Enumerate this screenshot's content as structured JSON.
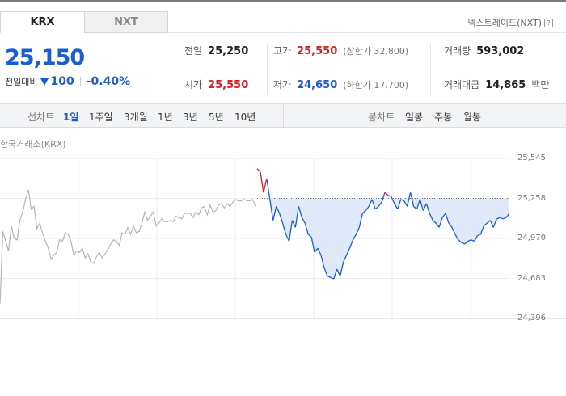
{
  "tabs": {
    "krx": "KRX",
    "nxt": "NXT"
  },
  "nxt_link": "넥스트레이드(NXT)",
  "price": "25,150",
  "change": {
    "label": "전일대비",
    "amount": "100",
    "percent": "-0.40%"
  },
  "stats": {
    "prev_label": "전일",
    "prev": "25,250",
    "open_label": "시가",
    "open": "25,550",
    "high_label": "고가",
    "high": "25,550",
    "upper_limit": "(상한가 32,800)",
    "low_label": "저가",
    "low": "24,650",
    "lower_limit": "(하한가 17,700)",
    "volume_label": "거래량",
    "volume": "593,002",
    "amount_label": "거래대금",
    "amount": "14,865",
    "amount_unit": "백만"
  },
  "period": {
    "line_label": "선차트",
    "line_items": [
      "1일",
      "1주일",
      "3개월",
      "1년",
      "3년",
      "5년",
      "10년"
    ],
    "active": "1일",
    "candle_label": "봉차트",
    "candle_items": [
      "일봉",
      "주봉",
      "월봉"
    ]
  },
  "exchange_label": "한국거래소(KRX)",
  "colors": {
    "up": "#d91e1e",
    "down": "#1a5cd2",
    "previous_day": "#b5b5b5",
    "fill": "#dfe9f8"
  },
  "chart_data": {
    "type": "line",
    "ylim": [
      24396,
      25545
    ],
    "yticks": [
      "25,545",
      "25,258",
      "24,970",
      "24,683",
      "24,396"
    ],
    "baseline": 25258,
    "grid": true,
    "series": [
      {
        "values": [
          24500,
          25020,
          24950,
          24880,
          25060,
          24970,
          24960,
          25100,
          25160,
          25250,
          25320,
          25180,
          25200,
          25040,
          25080,
          25010,
          24950,
          24900,
          24820,
          24850,
          24870,
          24960,
          24950,
          25010,
          25000,
          24950,
          24850,
          24880,
          24870,
          24900,
          24830,
          24860,
          24800,
          24790,
          24840,
          24870,
          24830,
          24860,
          24890,
          24930,
          24960,
          24950,
          24920,
          25010,
          25000,
          25050,
          25000,
          25060,
          25010,
          25020,
          25080,
          25160,
          25100,
          25130,
          25160,
          25060,
          25080,
          25110,
          25090,
          25090,
          25100,
          25090,
          25130,
          25120,
          25110,
          25150,
          25150,
          25150,
          25120,
          25160,
          25140,
          25190,
          25200,
          25140,
          25210,
          25160,
          25170,
          25210,
          25220,
          25190,
          25220,
          25200,
          25230,
          25250,
          25240,
          25240,
          25250,
          25240,
          25240,
          25250,
          25200
        ]
      },
      {
        "values": [
          25470,
          25450,
          25300,
          25400,
          25250,
          25100,
          25200,
          25150,
          25080,
          25000,
          24950,
          25100,
          25050,
          25200,
          25120,
          25080,
          25000,
          24980,
          24870,
          24900,
          24850,
          24760,
          24700,
          24690,
          24680,
          24750,
          24700,
          24800,
          24850,
          24900,
          24960,
          25000,
          25050,
          25150,
          25170,
          25200,
          25250,
          25180,
          25200,
          25230,
          25300,
          25280,
          25270,
          25220,
          25180,
          25250,
          25240,
          25200,
          25300,
          25200,
          25180,
          25250,
          25170,
          25220,
          25150,
          25100,
          25080,
          25050,
          25120,
          25150,
          25080,
          25050,
          25000,
          24960,
          24940,
          24930,
          24950,
          24960,
          24950,
          24990,
          25000,
          25060,
          25080,
          25100,
          25050,
          25110,
          25120,
          25110,
          25120,
          25150
        ]
      }
    ]
  }
}
